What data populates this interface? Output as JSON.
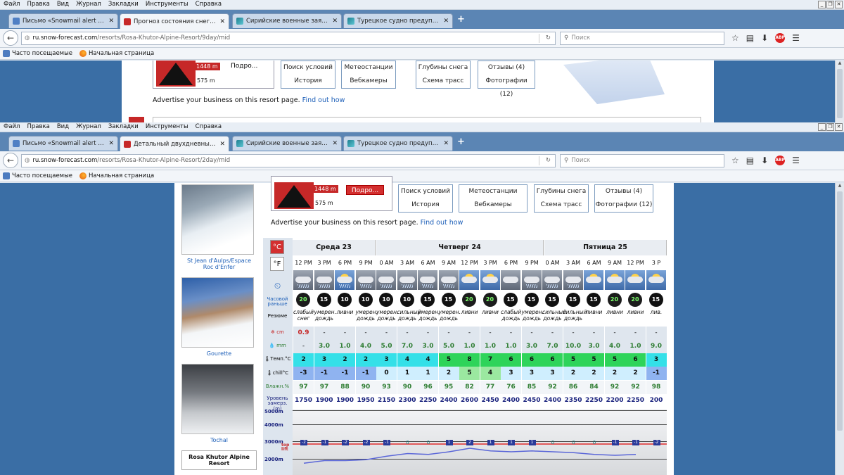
{
  "browser": {
    "menu": [
      "Файл",
      "Правка",
      "Вид",
      "Журнал",
      "Закладки",
      "Инструменты",
      "Справка"
    ],
    "search_placeholder": "Поиск",
    "bookmarks": [
      "Часто посещаемые",
      "Начальная страница"
    ],
    "back": {
      "tabs": [
        "Письмо «Snowmail alert for 4...",
        "Прогноз состояния снега и ...",
        "Сирийские военные заявил...",
        "Турецкое судно предупреж..."
      ],
      "url_domain": "ru.snow-forecast.com",
      "url_path": "/resorts/Rosa-Khutor-Alpine-Resort/9day/mid"
    },
    "front": {
      "tabs": [
        "Письмо «Snowmail alert for 4...",
        "Детальный двухдневный п...",
        "Сирийские военные заявил...",
        "Турецкое судно предупреж..."
      ],
      "url_domain": "ru.snow-forecast.com",
      "url_path": "/resorts/Rosa-Khutor-Alpine-Resort/2day/mid"
    }
  },
  "resort_header": {
    "elev_top": "1448 m",
    "elev_bottom": "575 m",
    "partial_label": "Подро...",
    "links": [
      [
        "Поиск условий",
        "История"
      ],
      [
        "Метеостанции",
        "Вебкамеры"
      ],
      [
        "Глубины снега",
        "Схема трасс"
      ],
      [
        "Отзывы (4)",
        "Фотографии (12)"
      ]
    ],
    "advertise": "Advertise your business on this resort page.",
    "advertise_link": "Find out how"
  },
  "sidebar": {
    "captions": [
      "St Jean d'Aulps/Espace Roc d'Enfer",
      "Gourette",
      "Tochal"
    ],
    "resort_box": "Rosa Khutor Alpine Resort"
  },
  "forecast": {
    "units": {
      "c": "°C",
      "f": "°F"
    },
    "row_labels": {
      "tz": "Часовой раньше",
      "summary": "Резюме",
      "snow": "cm",
      "rain": "mm",
      "temp": "Темп.°C",
      "chill": "chill°C",
      "humidity": "Влажн.%",
      "freezing": "Уровень замерз. (m)"
    },
    "days": [
      "Среда 23",
      "Четверг 24",
      "Пятница 25"
    ],
    "times": [
      "12 PM",
      "3 PM",
      "6 PM",
      "9 PM",
      "0 AM",
      "3 AM",
      "6 AM",
      "9 AM",
      "12 PM",
      "3 PM",
      "6 PM",
      "9 PM",
      "0 AM",
      "3 AM",
      "6 AM",
      "9 AM",
      "12 PM",
      "3 P"
    ],
    "weather_icons": [
      "cloud-rain",
      "cloud-rain",
      "sun-cloud-rain",
      "cloud-rain",
      "cloud-rain",
      "cloud-rain",
      "cloud-rain",
      "cloud-rain",
      "sun-cloud",
      "sun-cloud",
      "cloud-light",
      "cloud-rain",
      "cloud-rain",
      "cloud-rain",
      "sun-cloud",
      "sun-cloud",
      "sun-cloud",
      "sun-cloud"
    ],
    "wind": [
      "20",
      "15",
      "10",
      "10",
      "10",
      "10",
      "15",
      "15",
      "20",
      "20",
      "15",
      "15",
      "15",
      "15",
      "15",
      "20",
      "20",
      "15"
    ],
    "wind_green": [
      true,
      false,
      false,
      false,
      false,
      false,
      false,
      false,
      true,
      true,
      false,
      false,
      false,
      false,
      false,
      true,
      true,
      false
    ],
    "summary": [
      "слабый снег",
      "умерен. дождь",
      "ливни",
      "умерен. дождь",
      "умерен. дождь",
      "сильный дождь",
      "умерен. дождь",
      "умерен. дождь",
      "ливни",
      "ливни",
      "слабый дождь",
      "умерен. дождь",
      "сильный дождь",
      "сильный дождь",
      "ливни",
      "ливни",
      "ливни",
      "лив."
    ],
    "snow": [
      "0.9",
      "-",
      "-",
      "-",
      "-",
      "-",
      "-",
      "-",
      "-",
      "-",
      "-",
      "-",
      "-",
      "-",
      "-",
      "-",
      "-",
      "-"
    ],
    "rain": [
      "-",
      "3.0",
      "1.0",
      "4.0",
      "5.0",
      "7.0",
      "3.0",
      "5.0",
      "1.0",
      "1.0",
      "1.0",
      "3.0",
      "7.0",
      "10.0",
      "3.0",
      "4.0",
      "1.0",
      "9.0"
    ],
    "temp": [
      "2",
      "3",
      "2",
      "2",
      "3",
      "4",
      "4",
      "5",
      "8",
      "7",
      "6",
      "6",
      "6",
      "5",
      "5",
      "5",
      "6",
      "3"
    ],
    "chill": [
      "-3",
      "-1",
      "-1",
      "-1",
      "0",
      "1",
      "1",
      "2",
      "5",
      "4",
      "3",
      "3",
      "3",
      "2",
      "2",
      "2",
      "2",
      "-1"
    ],
    "humidity": [
      "97",
      "97",
      "88",
      "90",
      "93",
      "90",
      "96",
      "95",
      "82",
      "77",
      "76",
      "85",
      "92",
      "86",
      "84",
      "92",
      "92",
      "98"
    ],
    "freezing": [
      "1750",
      "1900",
      "1900",
      "1950",
      "2150",
      "2300",
      "2250",
      "2400",
      "2600",
      "2450",
      "2400",
      "2450",
      "2400",
      "2350",
      "2250",
      "2200",
      "2250",
      "200"
    ],
    "chart_pins": [
      "-2",
      "-1",
      "-2",
      "-2",
      "-1",
      "0",
      "0",
      "1",
      "2",
      "1",
      "1",
      "1",
      "0",
      "0",
      "0",
      "-1",
      "-1",
      "-2"
    ],
    "chart_y_labels": [
      "5000m",
      "4000m",
      "3000m",
      "2000m"
    ],
    "top_lift": "top lift"
  },
  "colors": {
    "brand_red": "#c62828",
    "link_blue": "#1d5fb8",
    "temp_cool": "#34e0e8",
    "temp_warm": "#2ed45a",
    "chill_cold": "#8fb3f0"
  }
}
